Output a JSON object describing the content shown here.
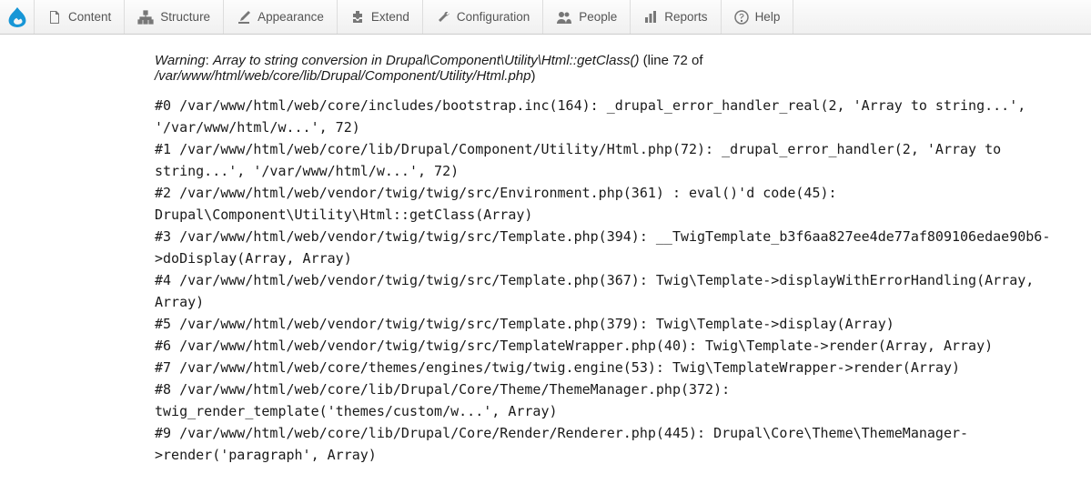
{
  "toolbar": {
    "items": [
      {
        "label": "Content"
      },
      {
        "label": "Structure"
      },
      {
        "label": "Appearance"
      },
      {
        "label": "Extend"
      },
      {
        "label": "Configuration"
      },
      {
        "label": "People"
      },
      {
        "label": "Reports"
      },
      {
        "label": "Help"
      }
    ]
  },
  "warning": {
    "prefix": "Warning",
    "message": "Array to string conversion in",
    "code": "Drupal\\Component\\Utility\\Html::getClass()",
    "line_label": "(line",
    "line_number": "72",
    "of": "of",
    "file": "/var/www/html/web/core/lib/Drupal/Component/Utility/Html.php",
    "close_paren": ")"
  },
  "trace": "#0 /var/www/html/web/core/includes/bootstrap.inc(164): _drupal_error_handler_real(2, 'Array to string...', '/var/www/html/w...', 72)\n#1 /var/www/html/web/core/lib/Drupal/Component/Utility/Html.php(72): _drupal_error_handler(2, 'Array to string...', '/var/www/html/w...', 72)\n#2 /var/www/html/web/vendor/twig/twig/src/Environment.php(361) : eval()'d code(45): Drupal\\Component\\Utility\\Html::getClass(Array)\n#3 /var/www/html/web/vendor/twig/twig/src/Template.php(394): __TwigTemplate_b3f6aa827ee4de77af809106edae90b6->doDisplay(Array, Array)\n#4 /var/www/html/web/vendor/twig/twig/src/Template.php(367): Twig\\Template->displayWithErrorHandling(Array, Array)\n#5 /var/www/html/web/vendor/twig/twig/src/Template.php(379): Twig\\Template->display(Array)\n#6 /var/www/html/web/vendor/twig/twig/src/TemplateWrapper.php(40): Twig\\Template->render(Array, Array)\n#7 /var/www/html/web/core/themes/engines/twig/twig.engine(53): Twig\\TemplateWrapper->render(Array)\n#8 /var/www/html/web/core/lib/Drupal/Core/Theme/ThemeManager.php(372): twig_render_template('themes/custom/w...', Array)\n#9 /var/www/html/web/core/lib/Drupal/Core/Render/Renderer.php(445): Drupal\\Core\\Theme\\ThemeManager->render('paragraph', Array)"
}
